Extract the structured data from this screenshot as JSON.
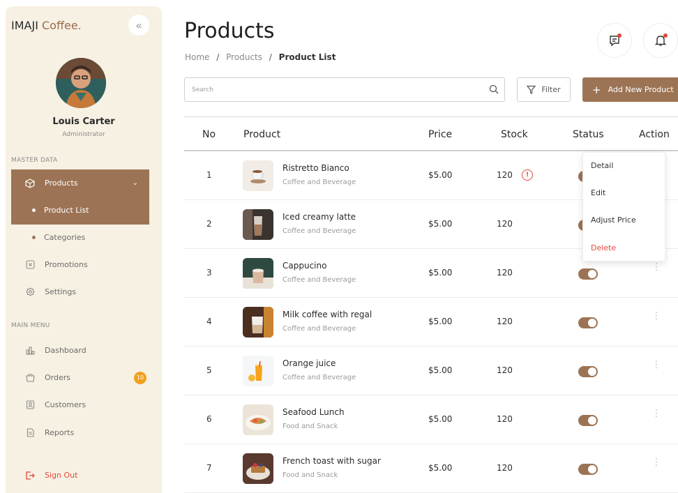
{
  "sidebar": {
    "brand_main": "IMAJI",
    "brand_accent": " Coffee.",
    "collapse_icon": "«",
    "user": {
      "name": "Louis Carter",
      "role": "Administrator"
    },
    "sections": {
      "master": "MASTER DATA",
      "main": "MAIN MENU"
    },
    "items": {
      "products": "Products",
      "product_list": "Product List",
      "categories": "Categories",
      "promotions": "Promotions",
      "settings": "Settings",
      "dashboard": "Dashboard",
      "orders": "Orders",
      "orders_badge": "10",
      "customers": "Customers",
      "reports": "Reports",
      "sign_out": "Sign Out"
    }
  },
  "header": {
    "title": "Products",
    "breadcrumb": {
      "home": "Home",
      "sep": "/",
      "products": "Products",
      "current": "Product List"
    }
  },
  "toolbar": {
    "search_placeholder": "Search",
    "filter_label": "Filter",
    "add_label": "Add New Product",
    "add_icon": "+"
  },
  "table": {
    "headers": {
      "no": "No",
      "product": "Product",
      "price": "Price",
      "stock": "Stock",
      "status": "Status",
      "action": "Action"
    },
    "rows": [
      {
        "no": "1",
        "name": "Ristretto Bianco",
        "category": "Coffee and Beverage",
        "price": "$5.00",
        "stock": "120",
        "warning": "!"
      },
      {
        "no": "2",
        "name": "Iced creamy latte",
        "category": "Coffee and Beverage",
        "price": "$5.00",
        "stock": "120"
      },
      {
        "no": "3",
        "name": "Cappucino",
        "category": "Coffee and Beverage",
        "price": "$5.00",
        "stock": "120"
      },
      {
        "no": "4",
        "name": "Milk coffee with regal",
        "category": "Coffee and Beverage",
        "price": "$5.00",
        "stock": "120"
      },
      {
        "no": "5",
        "name": "Orange juice",
        "category": "Coffee and Beverage",
        "price": "$5.00",
        "stock": "120"
      },
      {
        "no": "6",
        "name": "Seafood Lunch",
        "category": "Food and Snack",
        "price": "$5.00",
        "stock": "120"
      },
      {
        "no": "7",
        "name": "French toast with sugar",
        "category": "Food and Snack",
        "price": "$5.00",
        "stock": "120"
      }
    ]
  },
  "action_menu": {
    "detail": "Detail",
    "edit": "Edit",
    "adjust_price": "Adjust Price",
    "delete": "Delete"
  },
  "colors": {
    "accent": "#9c7455",
    "sidebar_bg": "#f7f1e3",
    "danger": "#e0483a",
    "badge": "#f0a020"
  }
}
